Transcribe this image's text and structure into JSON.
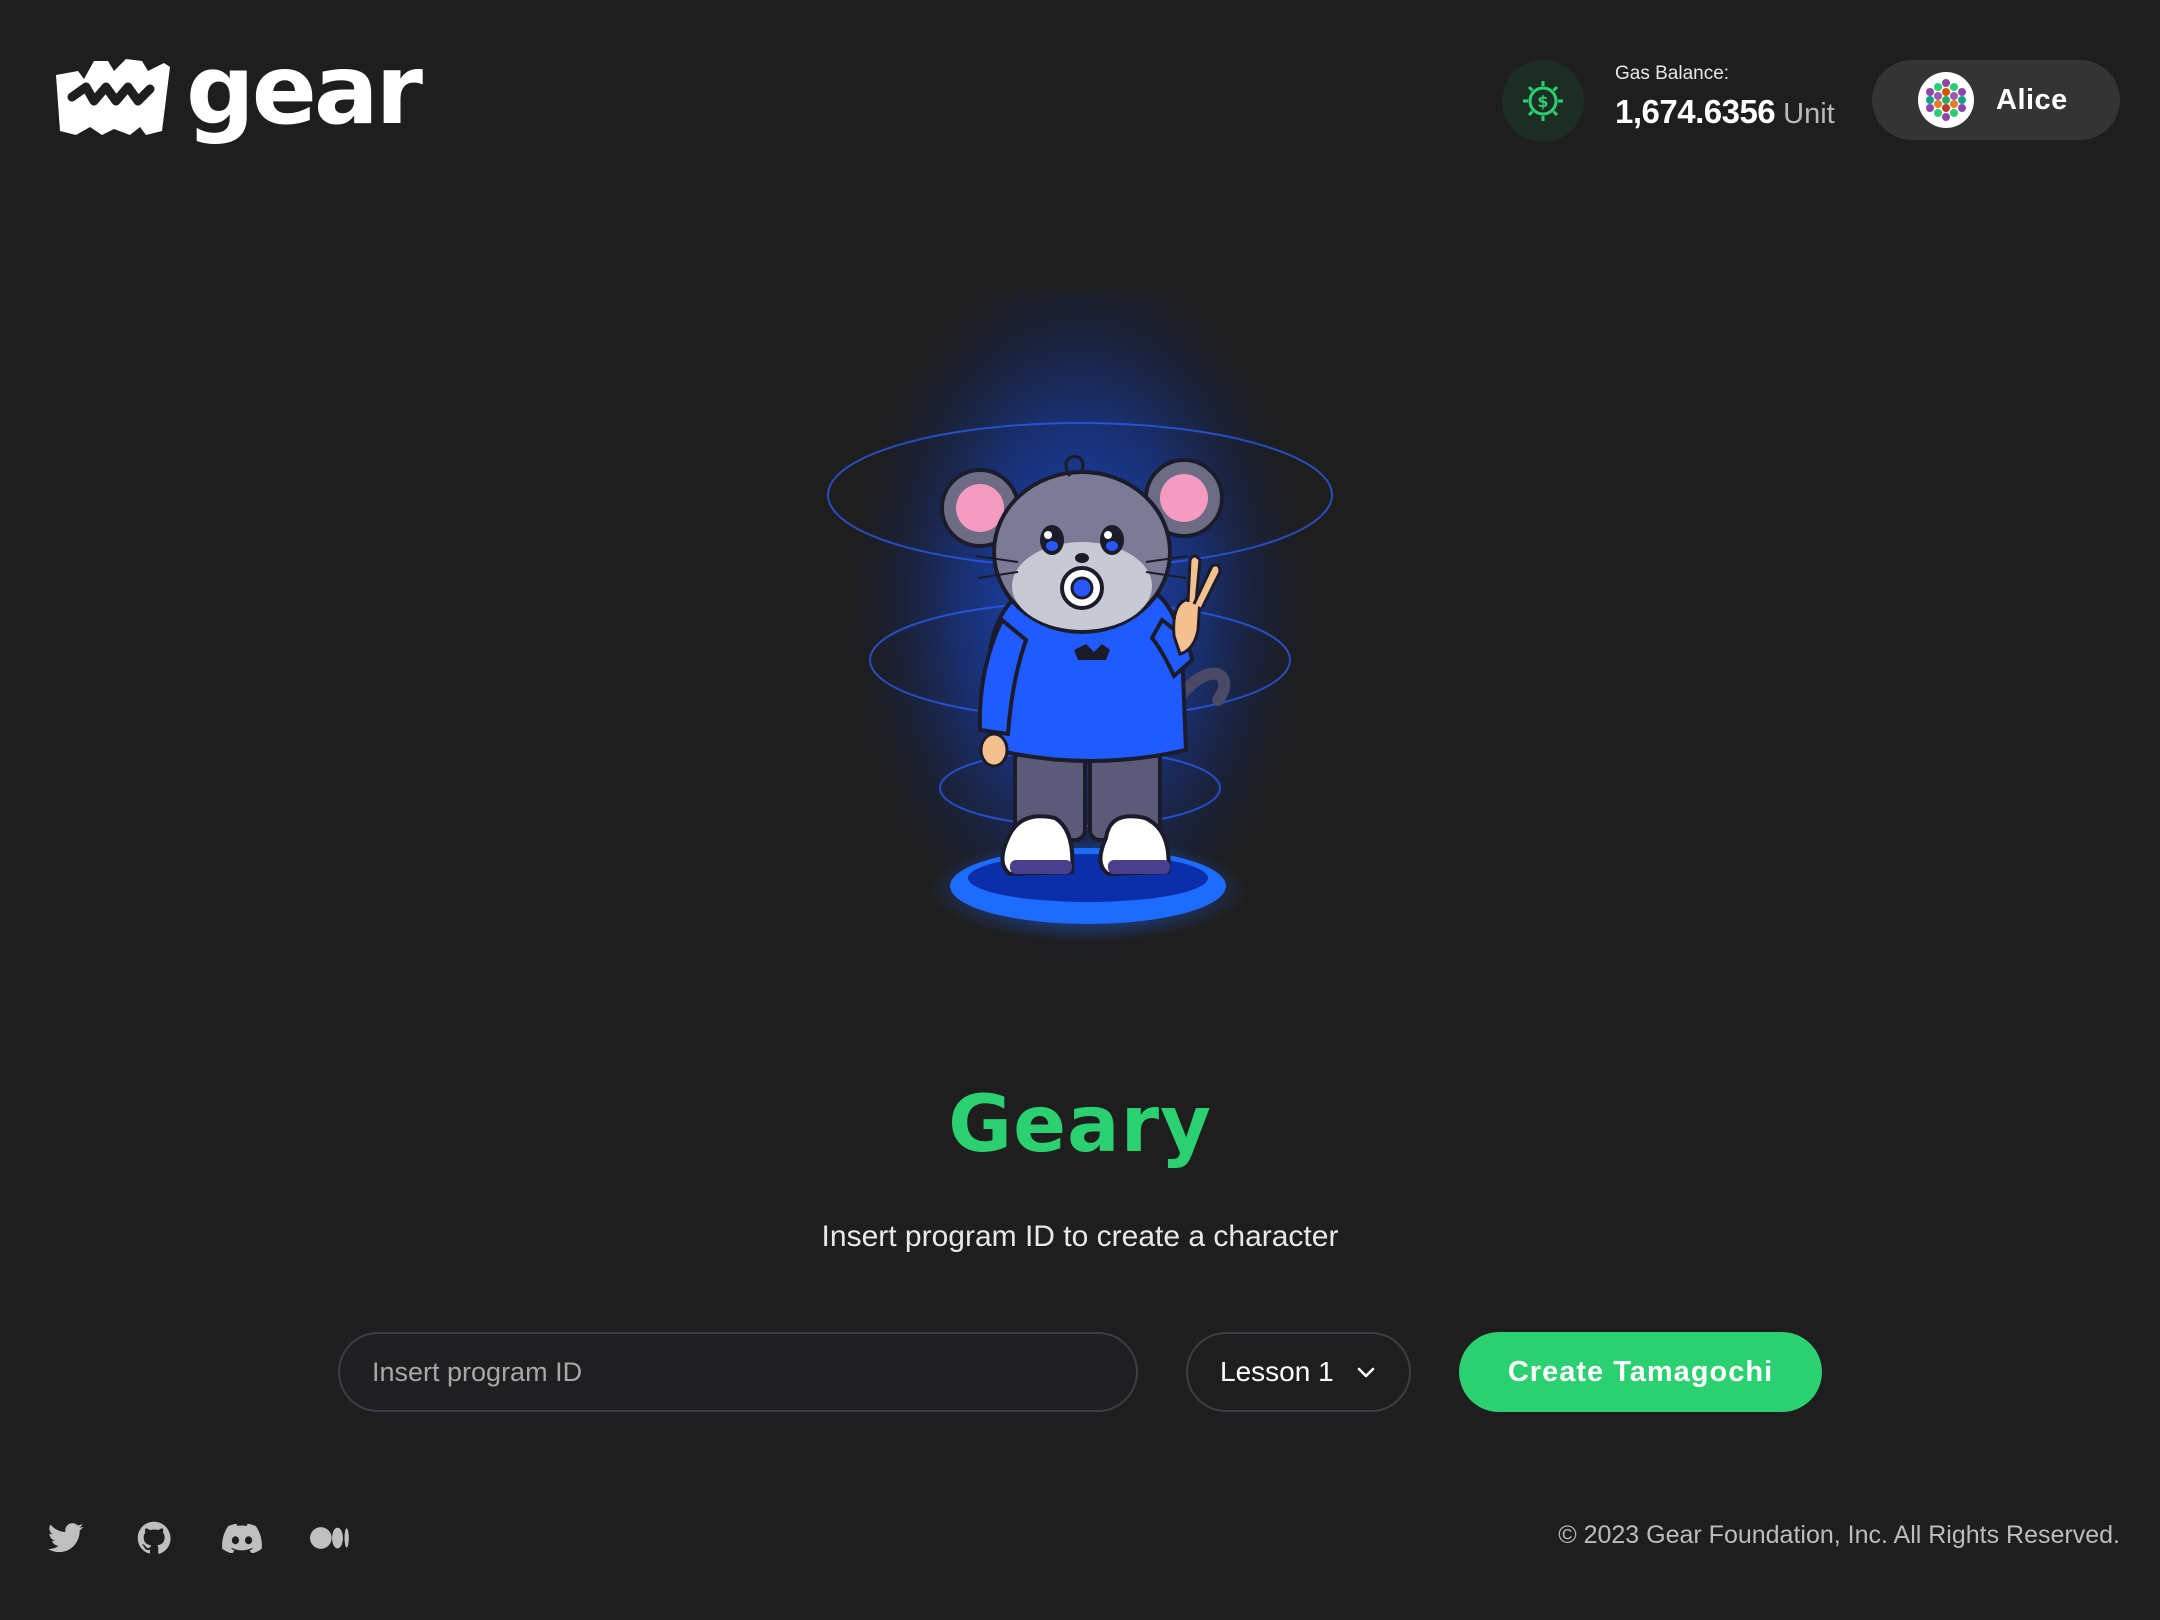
{
  "header": {
    "logo_text": "gear",
    "logo_icon": "gear-crown-logo",
    "gas": {
      "icon": "gas-coin-gear-icon",
      "label": "Gas Balance:",
      "amount": "1,674.6356",
      "unit": "Unit"
    },
    "account": {
      "avatar_icon": "polkadot-identicon",
      "name": "Alice"
    }
  },
  "hero": {
    "image": "geary-mouse-character",
    "title": "Geary",
    "subtitle": "Insert program ID to create a character"
  },
  "form": {
    "program_id_placeholder": "Insert program ID",
    "program_id_value": "",
    "lesson_selected": "Lesson 1",
    "lesson_chevron_icon": "chevron-down-icon",
    "create_button": "Create Tamagochi"
  },
  "footer": {
    "socials": [
      "twitter-icon",
      "github-icon",
      "discord-icon",
      "medium-icon"
    ],
    "copyright": "© 2023 Gear Foundation, Inc. All Rights Reserved."
  },
  "colors": {
    "background": "#1e1e1e",
    "accent_green": "#2bd071",
    "glow_blue": "#1a5cff",
    "pill_dark": "#343434"
  }
}
